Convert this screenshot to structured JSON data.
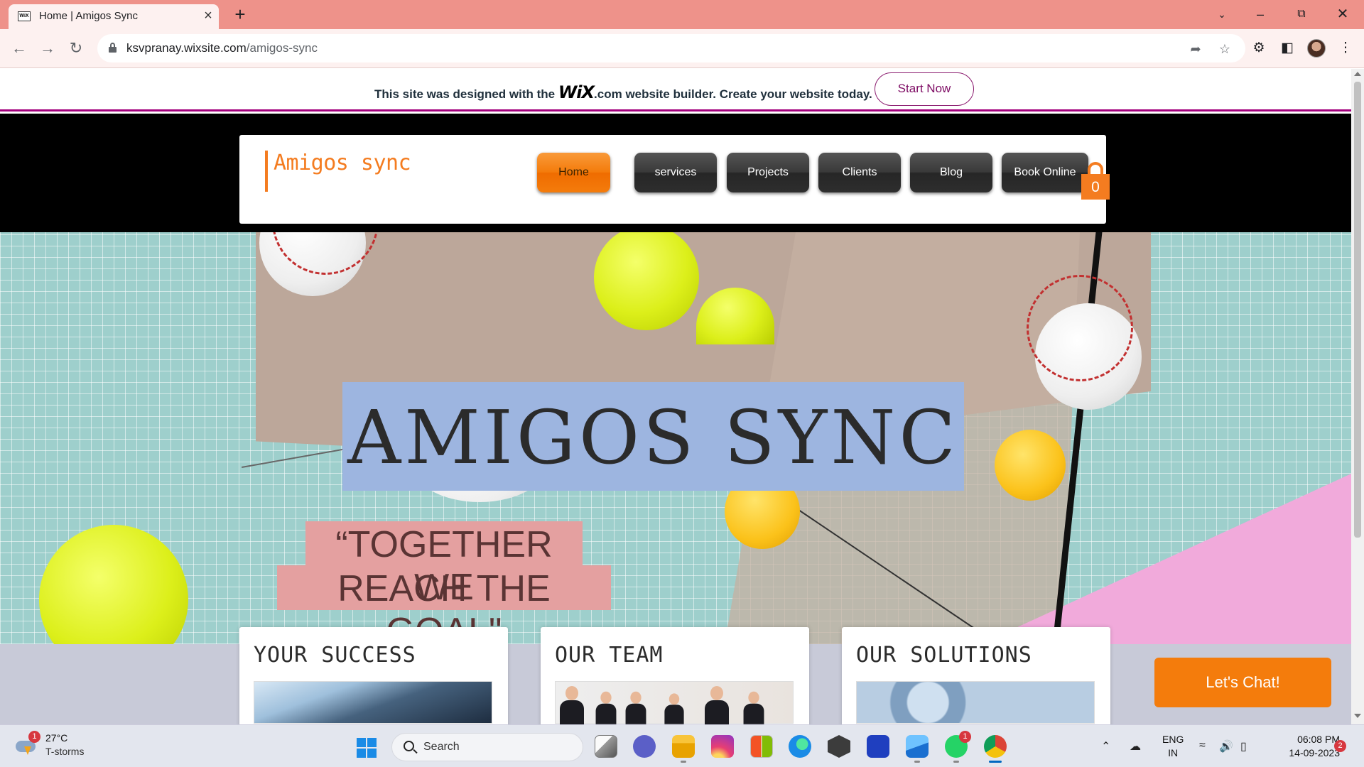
{
  "browser": {
    "tab_title": "Home | Amigos Sync",
    "tab_favicon": "WiX",
    "url_host": "ksvpranay.wixsite.com",
    "url_path": "/amigos-sync",
    "new_tab": "+",
    "close_tab": "×"
  },
  "wix_banner": {
    "text_before": "This site was designed with the ",
    "logo": "WiX",
    "logo_domain": ".com",
    "text_after": " website builder. Create your website today.",
    "cta": "Start Now"
  },
  "site": {
    "brand": "Amigos sync",
    "menu": [
      {
        "label": "Home",
        "active": true
      },
      {
        "label": "services",
        "active": false
      },
      {
        "label": "Projects",
        "active": false
      },
      {
        "label": "Clients",
        "active": false
      },
      {
        "label": "Blog",
        "active": false
      },
      {
        "label": "Book Online",
        "active": false
      }
    ],
    "cart_count": "0",
    "hero_title": "AMIGOS SYNC",
    "hero_quote_line1": "“TOGETHER WE",
    "hero_quote_line2": "REACH THE GOAL\"",
    "cards": [
      {
        "title": "YOUR SUCCESS",
        "image": "office-building"
      },
      {
        "title": "OUR TEAM",
        "image": "business-team"
      },
      {
        "title": "OUR SOLUTIONS",
        "image": "gears"
      }
    ],
    "chat_button": "Let's Chat!",
    "accent_color": "#f47c20",
    "wix_color": "#a3007d"
  },
  "taskbar": {
    "weather_temp": "27°C",
    "weather_condition": "T-storms",
    "weather_badge": "1",
    "search_label": "Search",
    "whatsapp_badge": "1",
    "lang_line1": "ENG",
    "lang_line2": "IN",
    "time": "06:08 PM",
    "date": "14-09-2023",
    "notification_count": "2"
  }
}
